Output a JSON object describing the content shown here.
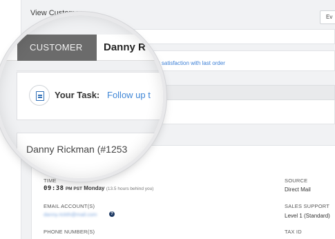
{
  "page": {
    "title": "View Customer",
    "top_button": "Ev"
  },
  "customer_tab": {
    "label": "CUSTOMER",
    "name_partial": "Danny R"
  },
  "task": {
    "label": "Your Task:",
    "text_partial": "Follow up t",
    "satisfaction_text": "r satisfaction with last order"
  },
  "customer": {
    "heading_partial": "Danny Rickman (#1253"
  },
  "details": {
    "time_label": "TIME",
    "time_value": "09:38",
    "time_suffix": "PM PST",
    "time_day": "Monday",
    "time_note": "(13.5 hours behind you)",
    "email_label": "EMAIL ACCOUNT(S)",
    "email_value": "danny.rickth@mail.com",
    "phone_label": "PHONE NUMBER(S)",
    "source_label": "SOURCE",
    "source_value": "Direct Mail",
    "support_label": "SALES SUPPORT",
    "support_value": "Level 1 (Standard)",
    "tax_label": "TAX ID"
  }
}
